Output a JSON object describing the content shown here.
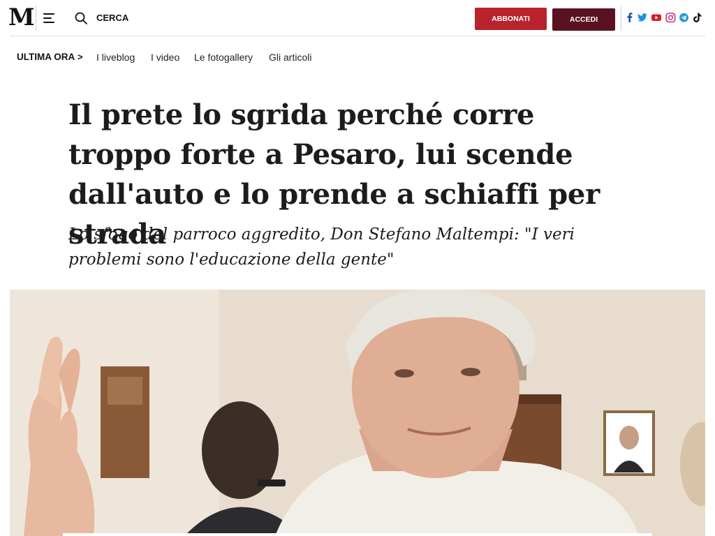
{
  "header": {
    "logo_text": "M",
    "search_label": "CERCA",
    "subscribe_label": "ABBONATI",
    "login_label": "ACCEDI",
    "subscribe_color": "#b8232e",
    "login_color": "#5a1122",
    "social_icons": [
      "facebook-icon",
      "twitter-icon",
      "youtube-icon",
      "instagram-icon",
      "telegram-icon",
      "tiktok-icon"
    ]
  },
  "subnav": {
    "ultima_ora": "ULTIMA ORA",
    "chevron": ">",
    "links": [
      "I liveblog",
      "I video",
      "Le fotogallery",
      "Gli articoli"
    ]
  },
  "article": {
    "headline": "Il prete lo sgrida perché corre troppo forte a Pesaro, lui scende dall'auto e lo prende a schiaffi per strada",
    "subtitle": "Lo sfogo del parroco aggredito, Don Stefano Maltempi: \"I veri problemi sono l'educazione della gente\""
  }
}
